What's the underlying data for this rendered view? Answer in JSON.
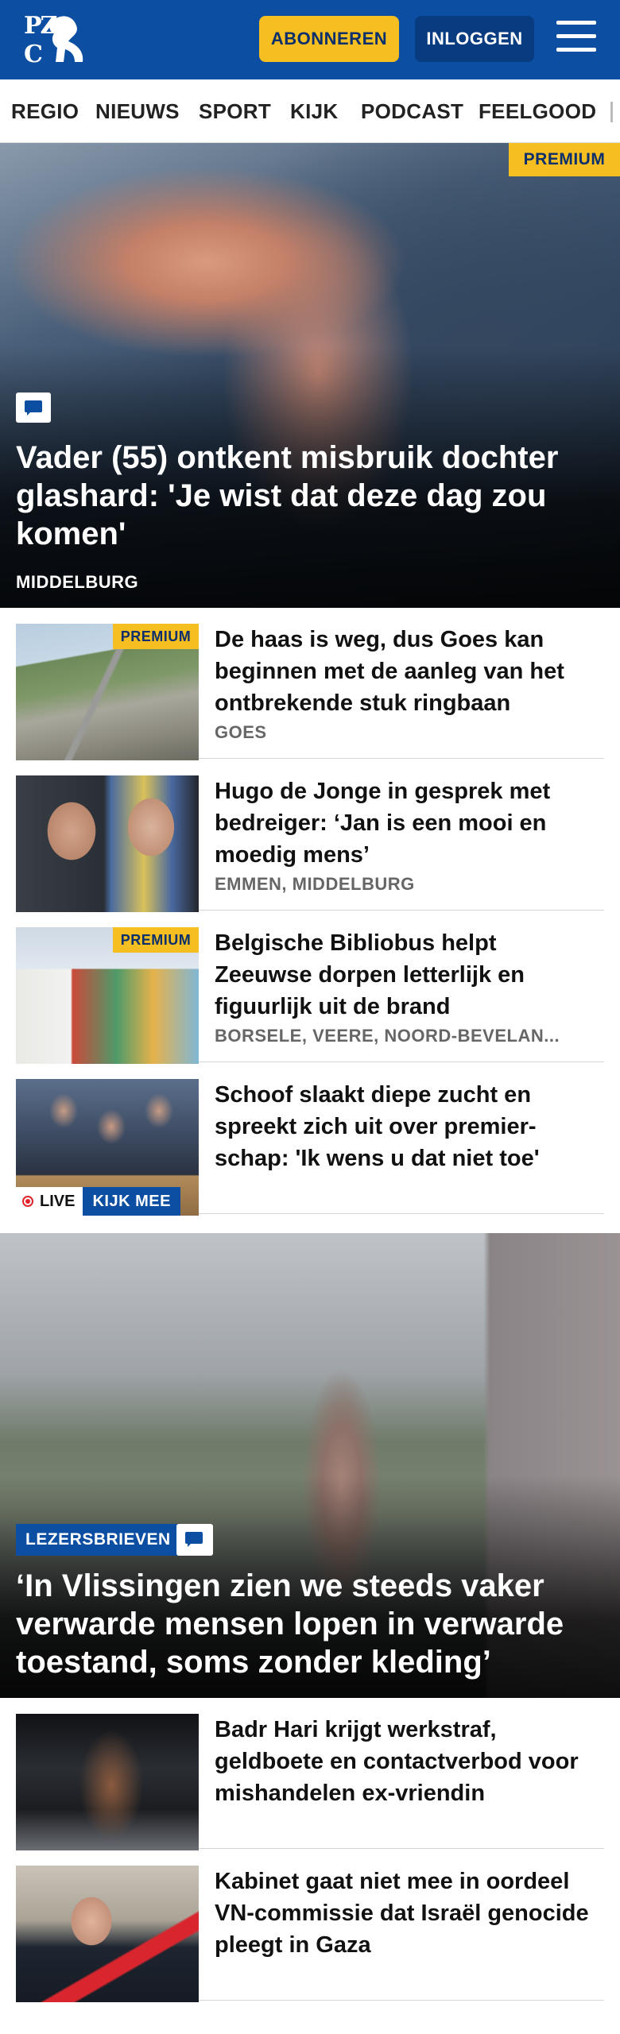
{
  "header": {
    "logo_text": "PZC",
    "subscribe_label": "ABONNEREN",
    "login_label": "INLOGGEN",
    "brand_color": "#0b4ea2",
    "accent_color": "#f5bf22"
  },
  "nav": {
    "items": [
      "REGIO",
      "NIEUWS",
      "SPORT",
      "KIJK",
      "PODCAST",
      "FEELGOOD"
    ]
  },
  "hero": {
    "premium_label": "PREMIUM",
    "title": "Vader (55) ontkent misbruik dochter glashard: 'Je wist dat deze dag zou komen'",
    "location": "MIDDELBURG"
  },
  "articles": [
    {
      "premium_label": "PREMIUM",
      "title": "De haas is weg, dus Goes kan beginnen met de aanleg van het ontbrekende stuk ringbaan",
      "location": "GOES"
    },
    {
      "title": "Hugo de Jonge in gesprek met bedreiger: ‘Jan is een mooi en moedig mens’",
      "location": "EMMEN, MIDDELBURG"
    },
    {
      "premium_label": "PREMIUM",
      "title": "Belgische Bibliobus helpt Zeeuwse dorpen letterlijk en figuurlijk uit de brand",
      "location": "BORSELE, VEERE, NOORD-BEVELAN..."
    },
    {
      "title": "Schoof slaakt diepe zucht en spreekt zich uit over premier-schap: 'Ik wens u dat niet toe'",
      "live_label": "LIVE",
      "watch_label": "KIJK MEE"
    }
  ],
  "feature": {
    "tag_label": "LEZERSBRIEVEN",
    "title": "‘In Vlissingen zien we steeds vaker verwarde mensen lopen in verwarde toestand, soms zonder kleding’"
  },
  "more_articles": [
    {
      "title": "Badr Hari krijgt werkstraf, geldboete en contactverbod voor mishandelen ex-vriendin"
    },
    {
      "title": "Kabinet gaat niet mee in oordeel VN-commissie dat Israël genocide pleegt in Gaza"
    }
  ]
}
